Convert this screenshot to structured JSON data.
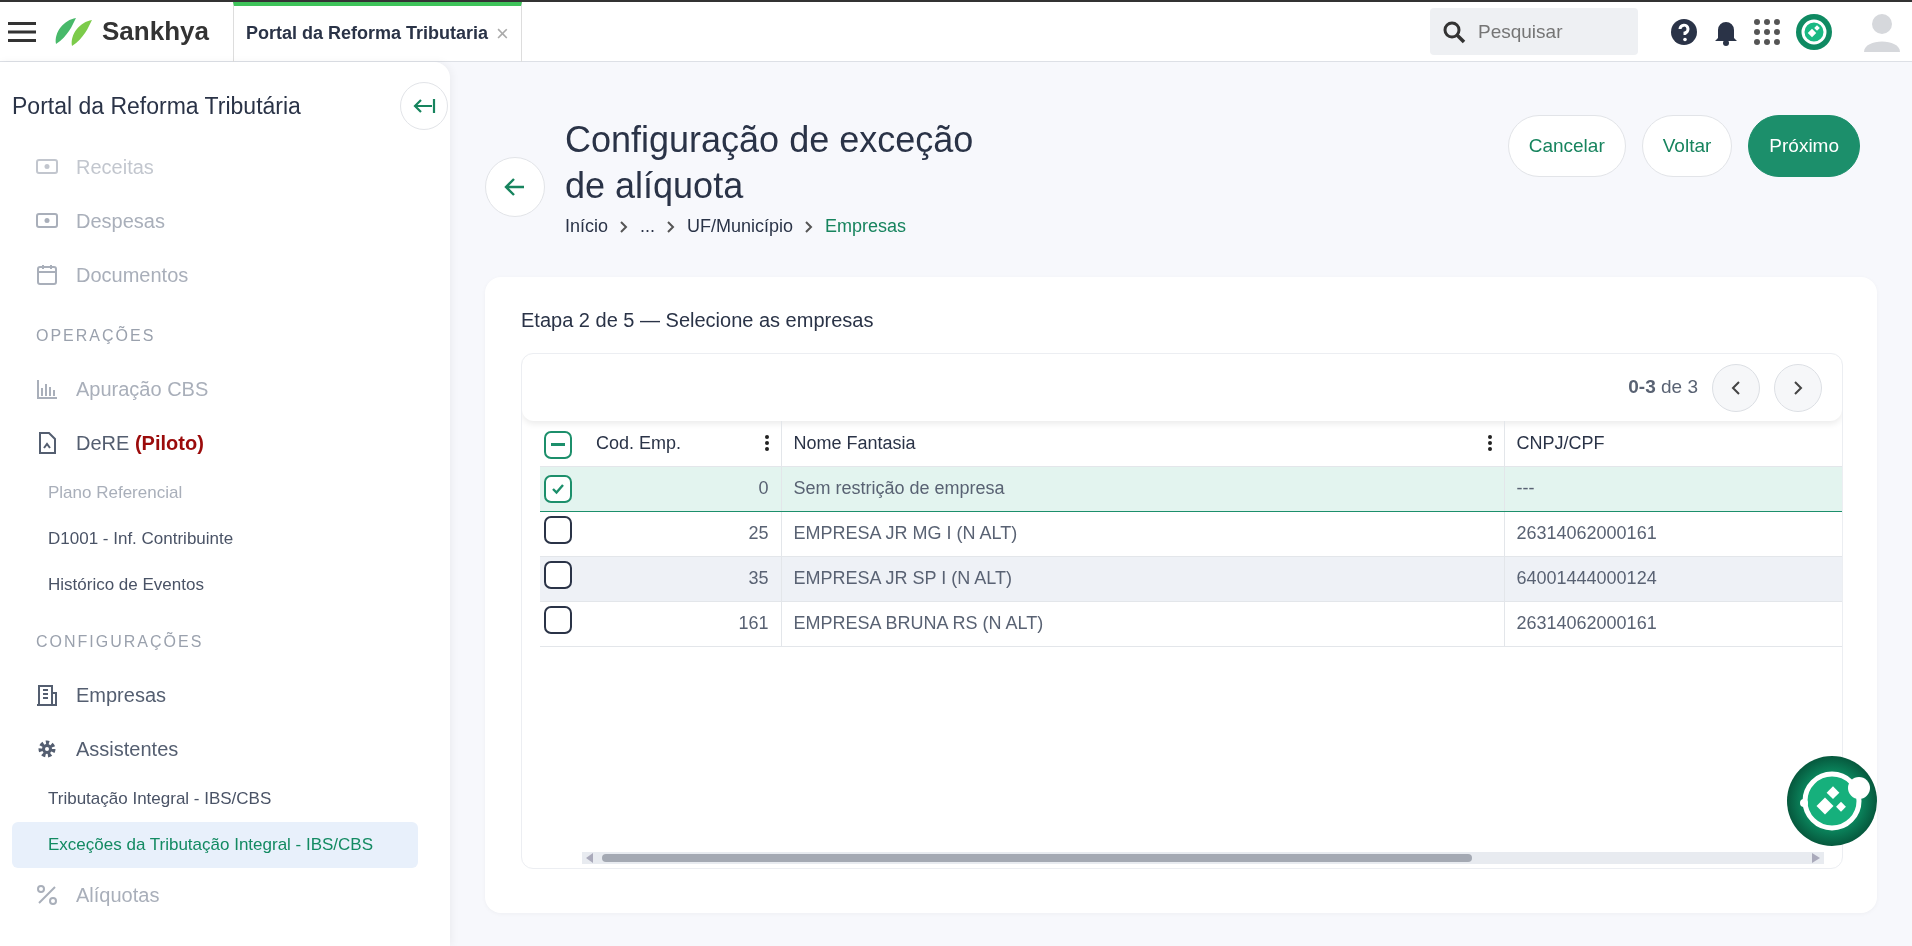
{
  "topbar": {
    "brand": "Sankhya",
    "tab": {
      "label": "Portal da Reforma Tributaria",
      "close": "×",
      "selected": true
    },
    "search": {
      "placeholder": "Pesquisar"
    }
  },
  "sidebar": {
    "title": "Portal da Reforma Tributária",
    "items": [
      {
        "kind": "item",
        "label": "Receitas",
        "disabled": true,
        "selected": false
      },
      {
        "kind": "item",
        "label": "Despesas",
        "disabled": true,
        "selected": false
      },
      {
        "kind": "item",
        "label": "Documentos",
        "disabled": true,
        "selected": false
      },
      {
        "kind": "section",
        "label": "OPERAÇÕES"
      },
      {
        "kind": "item",
        "label": "Apuração CBS",
        "disabled": true,
        "selected": false
      },
      {
        "kind": "item",
        "label": "DeRE",
        "tag": "(Piloto)",
        "disabled": false,
        "selected": false
      },
      {
        "kind": "subitem",
        "label": "Plano Referencial",
        "disabled": true,
        "selected": false
      },
      {
        "kind": "subitem",
        "label": "D1001 - Inf. Contribuinte",
        "disabled": false,
        "selected": false
      },
      {
        "kind": "subitem",
        "label": "Histórico de Eventos",
        "disabled": false,
        "selected": false
      },
      {
        "kind": "section",
        "label": "CONFIGURAÇÕES"
      },
      {
        "kind": "item",
        "label": "Empresas",
        "disabled": false,
        "selected": false
      },
      {
        "kind": "item",
        "label": "Assistentes",
        "disabled": false,
        "selected": false
      },
      {
        "kind": "subitem",
        "label": "Tributação Integral - IBS/CBS",
        "disabled": false,
        "selected": false
      },
      {
        "kind": "subitem",
        "label": "Exceções da Tributação Integral - IBS/CBS",
        "disabled": false,
        "selected": true
      },
      {
        "kind": "item",
        "label": "Alíquotas",
        "disabled": true,
        "selected": false
      }
    ]
  },
  "header": {
    "title": "Configuração de exceção de alíquota",
    "breadcrumb": [
      {
        "label": "Início",
        "selected": false
      },
      {
        "label": "...",
        "selected": false
      },
      {
        "label": "UF/Município",
        "selected": false
      },
      {
        "label": "Empresas",
        "selected": true
      }
    ],
    "buttons": [
      {
        "label": "Cancelar",
        "kind": "outline"
      },
      {
        "label": "Voltar",
        "kind": "outline"
      },
      {
        "label": "Próximo",
        "kind": "primary"
      }
    ]
  },
  "step": "Etapa 2 de 5 — Selecione as empresas",
  "pagination": {
    "range": "0-3",
    "total": "de 3"
  },
  "table": {
    "header_checkbox": {
      "indeterminate": true
    },
    "columns": [
      "Cod. Emp.",
      "Nome Fantasia",
      "CNPJ/CPF"
    ],
    "rows": [
      {
        "code": "0",
        "name": "Sem restrição de empresa",
        "cnpj": "---",
        "checked": true,
        "selected": true,
        "hovered": false
      },
      {
        "code": "25",
        "name": "EMPRESA JR MG I (N ALT)",
        "cnpj": "26314062000161",
        "checked": false,
        "selected": false,
        "hovered": false
      },
      {
        "code": "35",
        "name": "EMPRESA JR SP I (N ALT)",
        "cnpj": "64001444000124",
        "checked": false,
        "selected": false,
        "hovered": true
      },
      {
        "code": "161",
        "name": "EMPRESA BRUNA RS (N ALT)",
        "cnpj": "26314062000161",
        "checked": false,
        "selected": false,
        "hovered": false
      }
    ]
  }
}
